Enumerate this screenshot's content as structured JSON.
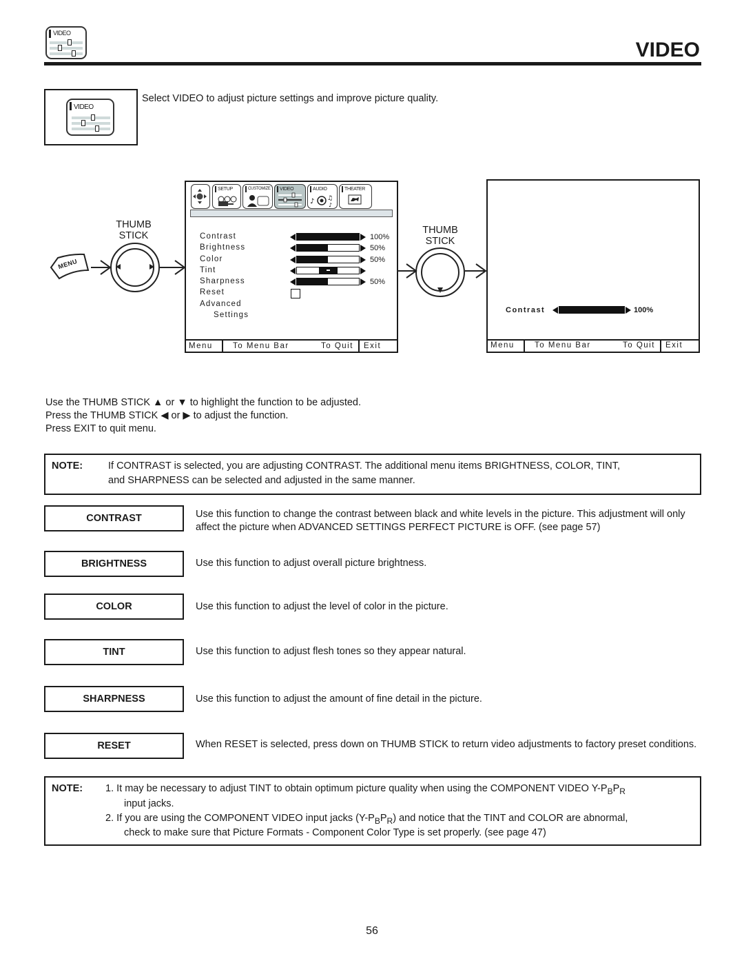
{
  "header": {
    "icon_label": "VIDEO",
    "title": "VIDEO"
  },
  "intro": {
    "icon_label": "VIDEO",
    "text": "Select VIDEO to adjust picture settings and improve picture quality."
  },
  "diagram": {
    "menu_button_label": "MENU",
    "thumb_stick_label_line1": "THUMB",
    "thumb_stick_label_line2": "STICK",
    "tabs": [
      {
        "label": "SETUP",
        "icon": "camera-icon",
        "active": false
      },
      {
        "label": "CUSTOMIZE",
        "icon": "person-icon",
        "active": false
      },
      {
        "label": "VIDEO",
        "icon": "sliders-icon",
        "active": true
      },
      {
        "label": "AUDIO",
        "icon": "music-icon",
        "active": false
      },
      {
        "label": "THEATER",
        "icon": "film-icon",
        "active": false
      }
    ],
    "nav_icon": "dpad-icon",
    "menu_items": [
      {
        "label": "Contrast",
        "value": 100,
        "value_text": "100%"
      },
      {
        "label": "Brightness",
        "value": 50,
        "value_text": "50%"
      },
      {
        "label": "Color",
        "value": 50,
        "value_text": "50%"
      },
      {
        "label": "Tint",
        "value": 50,
        "value_text": ""
      },
      {
        "label": "Sharpness",
        "value": 50,
        "value_text": "50%"
      },
      {
        "label": "Reset",
        "checkbox": true
      },
      {
        "label": "Advanced"
      },
      {
        "label": "Settings"
      }
    ],
    "footer": {
      "menu": "Menu",
      "to_menu_bar": "To Menu Bar",
      "to_quit": "To Quit",
      "exit": "Exit"
    },
    "detail": {
      "label": "Contrast",
      "value": 100,
      "value_text": "100%"
    }
  },
  "instructions": [
    "Use the THUMB STICK ▲ or ▼ to highlight the function to be adjusted.",
    "Press the THUMB STICK ◀ or ▶ to adjust the function.",
    "Press EXIT to quit menu."
  ],
  "note1": {
    "label": "NOTE:",
    "line1": "If CONTRAST is selected, you are adjusting CONTRAST.  The additional menu items BRIGHTNESS, COLOR, TINT,",
    "line2": "and SHARPNESS can be selected and adjusted in the same manner."
  },
  "functions": [
    {
      "name": "CONTRAST",
      "text": "Use this function to change the contrast between black and white levels in the picture.  This adjustment will only affect the picture when ADVANCED SETTINGS PERFECT PICTURE is OFF. (see page 57)"
    },
    {
      "name": "BRIGHTNESS",
      "text": "Use this function to adjust overall picture brightness."
    },
    {
      "name": "COLOR",
      "text": "Use this function to adjust the level of color in the picture."
    },
    {
      "name": "TINT",
      "text": "Use this function to adjust flesh tones so they appear natural."
    },
    {
      "name": "SHARPNESS",
      "text": "Use this function to adjust the amount of fine detail in the picture."
    },
    {
      "name": "RESET",
      "text": "When RESET is selected, press down on THUMB STICK to return video adjustments to factory preset conditions."
    }
  ],
  "note2": {
    "label": "NOTE:",
    "item1_a": "1.  It may be necessary to adjust TINT to obtain optimum picture quality when using the COMPONENT VIDEO Y-P",
    "item1_sub1": "B",
    "item1_mid": "P",
    "item1_sub2": "R",
    "item1_b": "input jacks.",
    "item2_a": "2.  If you are using the COMPONENT VIDEO input jacks (Y-P",
    "item2_sub1": "B",
    "item2_mid": "P",
    "item2_sub2": "R",
    "item2_c": ") and notice that the TINT and COLOR are abnormal,",
    "item2_b": "check to make sure that Picture Formats - Component Color Type is set properly. (see page 47)"
  },
  "page_number": "56"
}
